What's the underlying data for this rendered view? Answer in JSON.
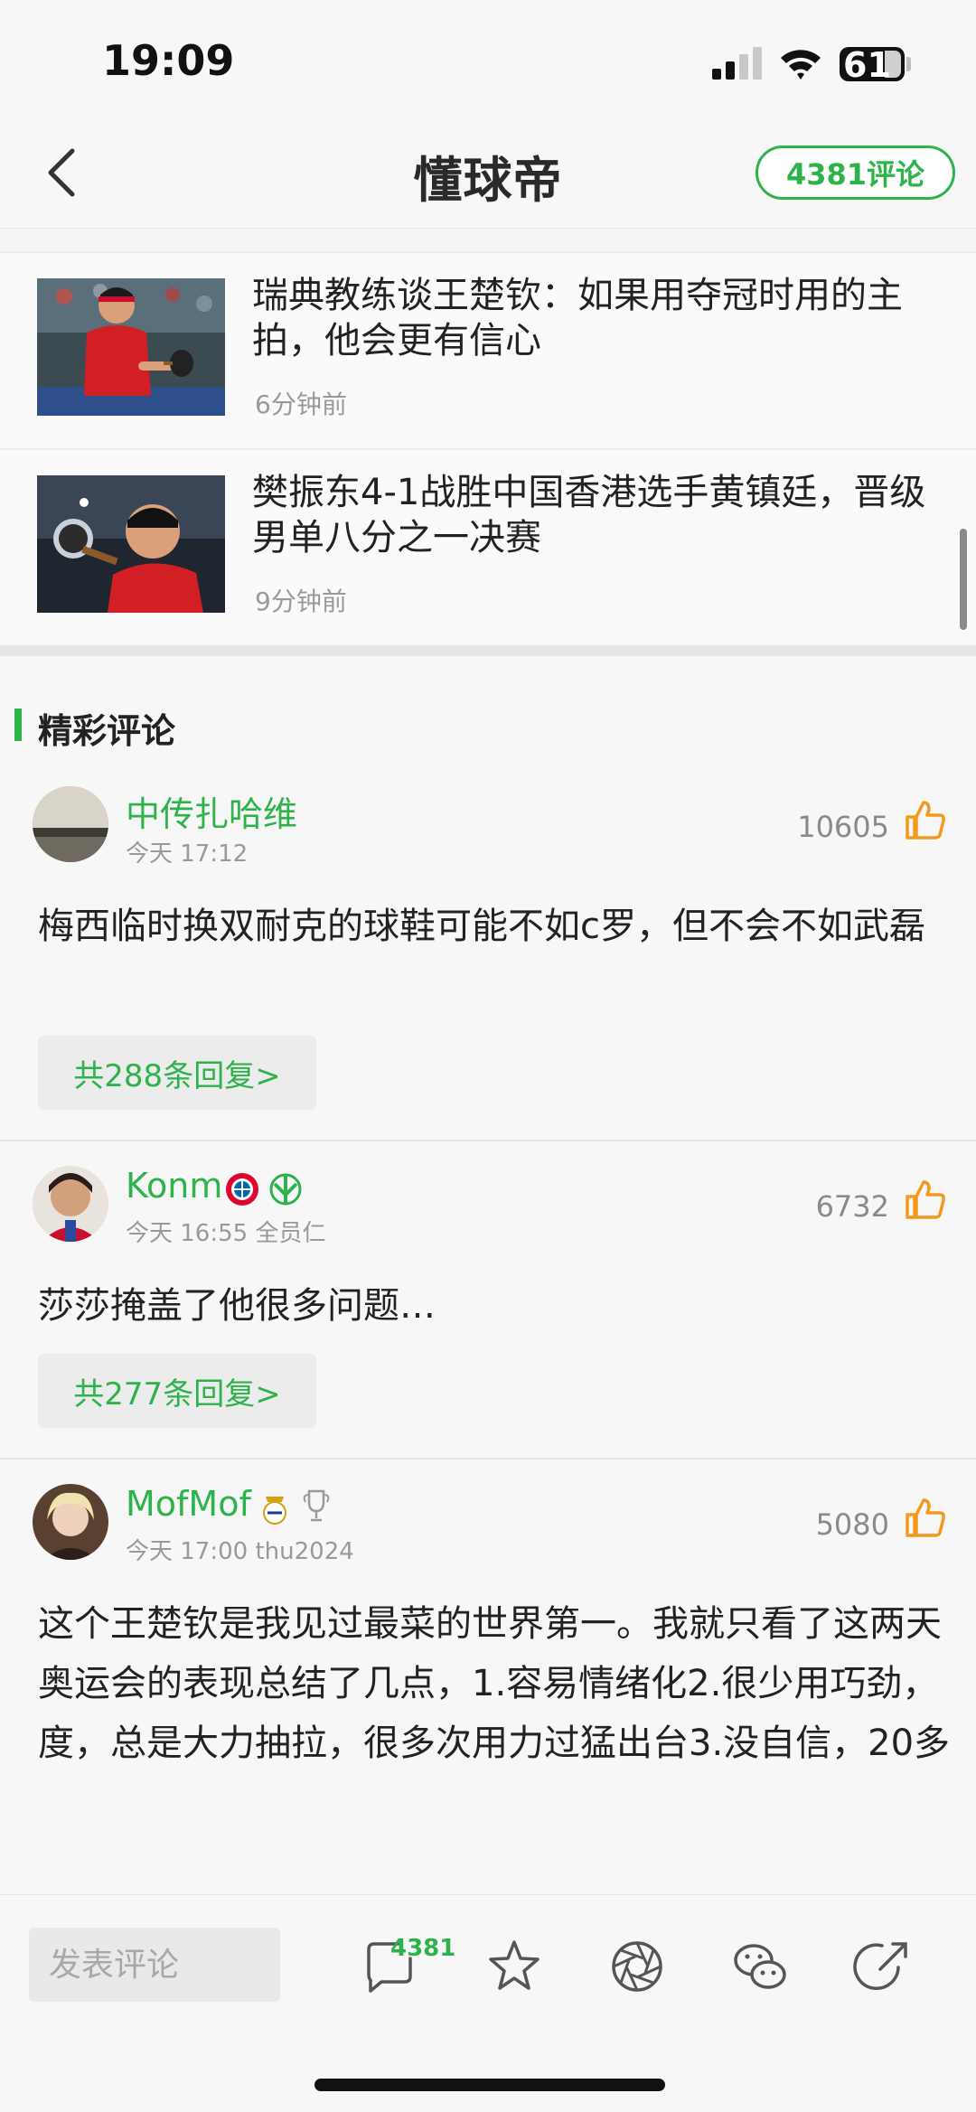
{
  "status": {
    "time": "19:09",
    "battery": "61"
  },
  "nav": {
    "title": "懂球帝",
    "comment_count_label": "4381评论"
  },
  "news": [
    {
      "title": "瑞典教练谈王楚钦：如果用夺冠时用的主拍，他会更有信心",
      "time": "6分钟前",
      "thumb_icon": "table-tennis-player-photo"
    },
    {
      "title": "樊振东4-1战胜中国香港选手黄镇廷，晋级男单八分之一决赛",
      "time": "9分钟前",
      "thumb_icon": "table-tennis-player-photo"
    }
  ],
  "comments_section": {
    "title": "精彩评论"
  },
  "comments": [
    {
      "username": "中传扎哈维",
      "time": "今天 17:12",
      "likes": "10605",
      "text": "梅西临时换双耐克的球鞋可能不如c罗，但不会不如武磊",
      "replies": "共288条回复>"
    },
    {
      "username": "Konm",
      "time": "今天 16:55 全员仁",
      "likes": "6732",
      "text": "莎莎掩盖了他很多问题…",
      "replies": "共277条回复>"
    },
    {
      "username": "MofMof",
      "time": "今天 17:00 thu2024",
      "likes": "5080",
      "text": "这个王楚钦是我见过最菜的世界第一。我就只看了这两天奥运会的表现总结了几点，1.容易情绪化2.很少用巧劲，度，总是大力抽拉，很多次用力过猛出台3.没自信，20多"
    }
  ],
  "bottom_bar": {
    "input_placeholder": "发表评论",
    "comment_count": "4381"
  },
  "colors": {
    "accent": "#2db34a",
    "like": "#f39a1e"
  }
}
